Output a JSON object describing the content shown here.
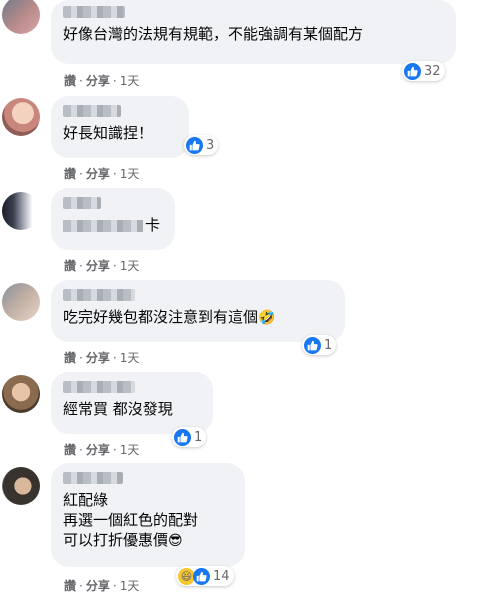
{
  "comments": [
    {
      "text": "好像台灣的法規有規範，不能強調有某個配方",
      "reactions": "32",
      "actions": {
        "like": "讚",
        "share": "分享",
        "time": "1天"
      }
    },
    {
      "name": "ㄌ一ㄢ",
      "text": "好長知識捏！",
      "reactions": "3",
      "actions": {
        "like": "讚",
        "share": "分享",
        "time": "1天"
      }
    },
    {
      "text_tail": "卡",
      "actions": {
        "like": "讚",
        "share": "分享",
        "time": "1天"
      }
    },
    {
      "text": "吃完好幾包都沒注意到有這個",
      "emoji": "🤣",
      "reactions": "1",
      "actions": {
        "like": "讚",
        "share": "分享",
        "time": "1天"
      }
    },
    {
      "text": "經常買 都沒發現",
      "reactions": "1",
      "actions": {
        "like": "讚",
        "share": "分享",
        "time": "1天"
      }
    },
    {
      "text": "紅配綠\n再選一個紅色的配對\n可以打折優惠價",
      "emoji": "😎",
      "reactions": "14",
      "actions": {
        "like": "讚",
        "share": "分享",
        "time": "1天"
      }
    }
  ],
  "colors": {
    "like_blue": "#1877f2",
    "bubble_bg": "#f0f2f5",
    "meta_gray": "#65676b"
  }
}
